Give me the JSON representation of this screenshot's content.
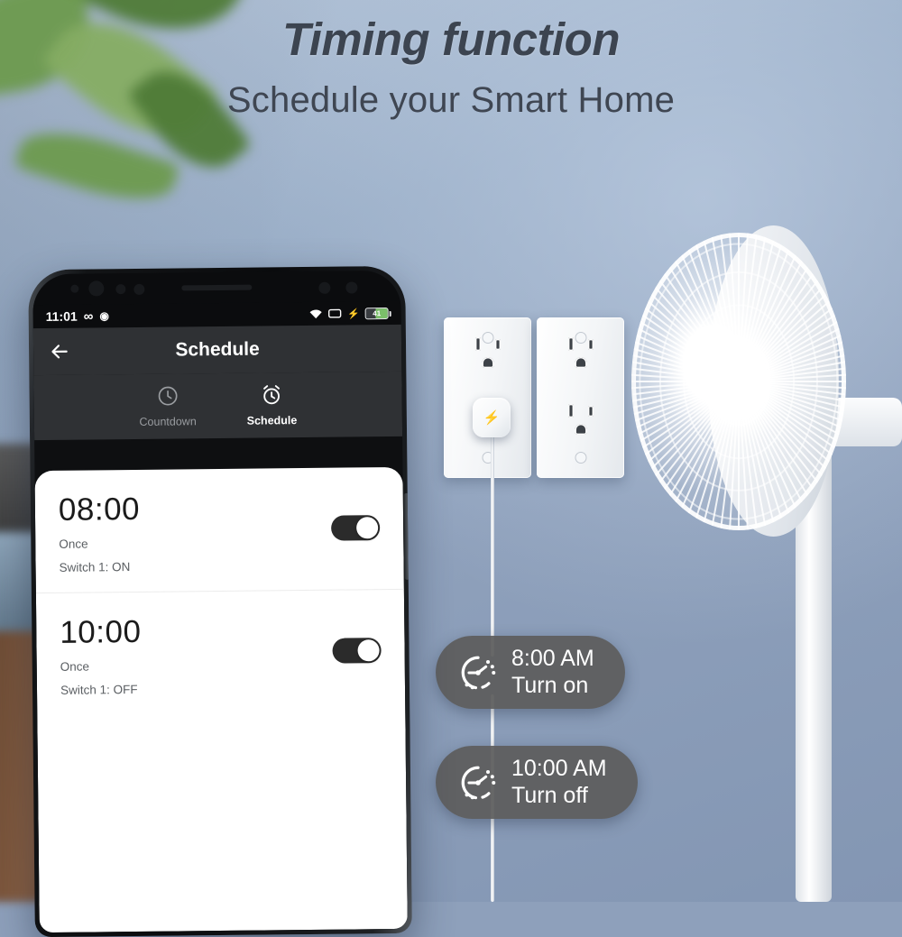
{
  "headline": {
    "title": "Timing function",
    "subtitle": "Schedule your Smart Home"
  },
  "colors": {
    "background": "#8ea0bb",
    "headline_text": "#3c4450",
    "badge_bg": "#5c5c5c",
    "app_header_bg": "#2f3134",
    "toggle_on": "#2b2b2b",
    "battery_fill": "#7bbf6a"
  },
  "phone": {
    "status_bar": {
      "time": "11:01",
      "icons_left": [
        "infinity-icon",
        "droplet-icon"
      ],
      "icons_right": [
        "wifi-icon",
        "cast-icon",
        "charging-bolt-icon"
      ],
      "battery_level": "41"
    },
    "app": {
      "back_icon": "back-arrow-icon",
      "title": "Schedule",
      "tabs": [
        {
          "label": "Countdown",
          "icon": "clock-icon",
          "active": false
        },
        {
          "label": "Schedule",
          "icon": "alarm-clock-icon",
          "active": true
        }
      ],
      "schedules": [
        {
          "time": "08:00",
          "repeat": "Once",
          "switch_state": "Switch 1: ON",
          "enabled": "true"
        },
        {
          "time": "10:00",
          "repeat": "Once",
          "switch_state": "Switch 1: OFF",
          "enabled": "true"
        }
      ]
    }
  },
  "badges": [
    {
      "icon": "timer-clock-icon",
      "time": "8:00 AM",
      "action": "Turn on"
    },
    {
      "icon": "timer-clock-icon",
      "time": "10:00 AM",
      "action": "Turn off"
    }
  ],
  "scene": {
    "outlets": "duplex-wall-outlet-pair",
    "smart_plug": "smart-plug-device",
    "appliance": "pedestal-fan"
  }
}
